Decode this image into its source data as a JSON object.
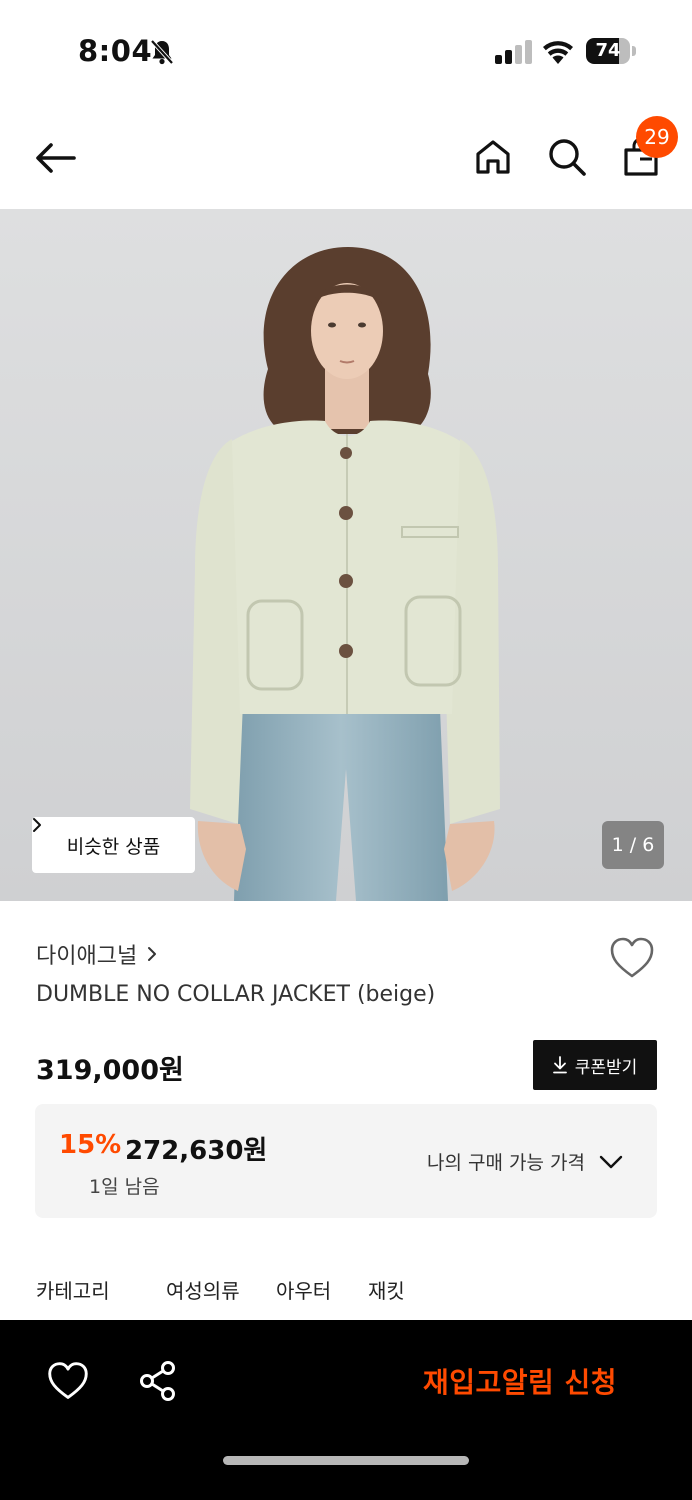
{
  "status_bar": {
    "time": "8:04",
    "battery_percent": 74,
    "battery_label": "74"
  },
  "header": {
    "cart_count": "29",
    "icons": [
      "back-arrow-icon",
      "home-icon",
      "search-icon",
      "shopping-bag-icon"
    ]
  },
  "hero": {
    "similar_label": "비슷한 상품",
    "page_counter": "1 / 6",
    "current_page": 1,
    "total_pages": 6
  },
  "product": {
    "brand": "다이애그널",
    "name": "DUMBLE NO COLLAR JACKET (beige)",
    "price": "319,000원",
    "coupon_label": "쿠폰받기",
    "discount_rate": "15%",
    "discount_price": "272,630원",
    "remaining": "1일 남음",
    "my_price_label": "나의 구매 가능 가격"
  },
  "category": {
    "label": "카테고리",
    "path": [
      "여성의류",
      "아우터",
      "재킷"
    ]
  },
  "bottom_bar": {
    "restock_label": "재입고알림 신청",
    "accent_color": "#ff4a00"
  }
}
